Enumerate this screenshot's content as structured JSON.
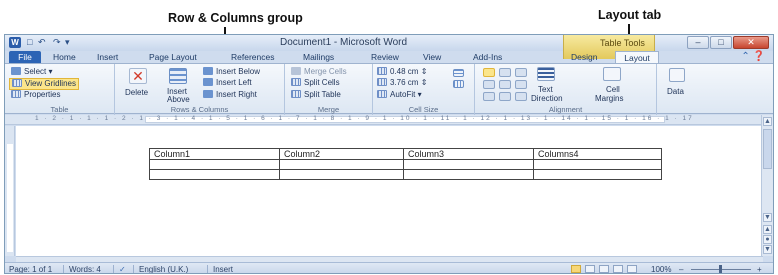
{
  "annotations": {
    "row_columns_group": "Row & Columns group",
    "layout_tab": "Layout tab"
  },
  "window": {
    "title": "Document1 - Microsoft Word",
    "context_tab_label": "Table Tools",
    "app_icon": "W",
    "min_label": "–",
    "max_label": "□",
    "close_label": "✕"
  },
  "tabs": {
    "file": "File",
    "home": "Home",
    "insert": "Insert",
    "page_layout": "Page Layout",
    "references": "References",
    "mailings": "Mailings",
    "review": "Review",
    "view": "View",
    "addins": "Add-Ins",
    "design": "Design",
    "layout": "Layout"
  },
  "ribbon": {
    "table": {
      "select": "Select ▾",
      "view_gridlines": "View Gridlines",
      "properties": "Properties",
      "label": "Table"
    },
    "rows_columns": {
      "delete": "Delete",
      "insert_above_1": "Insert",
      "insert_above_2": "Above",
      "insert_below": "Insert Below",
      "insert_left": "Insert Left",
      "insert_right": "Insert Right",
      "label": "Rows & Columns"
    },
    "merge": {
      "merge_cells": "Merge Cells",
      "split_cells": "Split Cells",
      "split_table": "Split Table",
      "label": "Merge"
    },
    "cell_size": {
      "height": "0.48 cm",
      "width": "3.76 cm",
      "autofit": "AutoFit ▾",
      "label": "Cell Size"
    },
    "alignment": {
      "text_direction_1": "Text",
      "text_direction_2": "Direction",
      "cell_margins_1": "Cell",
      "cell_margins_2": "Margins",
      "label": "Alignment"
    },
    "data": {
      "data": "Data"
    }
  },
  "ruler_text": "1 · 2 · 1 · 1 · 1 · 2 · 1 · 3 · 1 · 4 · 1 · 5 · 1 · 6 · 1 · 7 · 1 · 8 · 1 · 9 · 1 · 10 · 1 · 11 · 1 · 12 · 1 · 13 · 1 · 14 · 1 · 15 · 1 · 16 · 1 · 17",
  "document_table": {
    "headers": [
      "Column1",
      "Column2",
      "Column3",
      "Columns4"
    ]
  },
  "statusbar": {
    "page": "Page: 1 of 1",
    "words": "Words: 4",
    "language": "English (U.K.)",
    "mode": "Insert",
    "zoom": "100%",
    "zoom_out": "–",
    "zoom_in": "+"
  }
}
